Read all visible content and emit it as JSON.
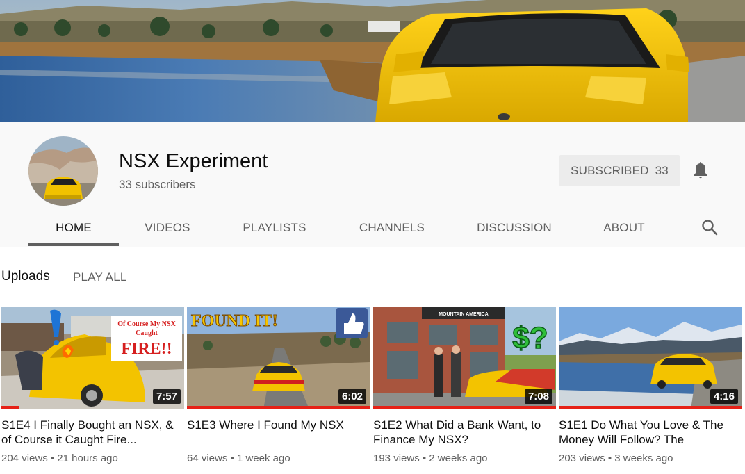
{
  "channel": {
    "name": "NSX Experiment",
    "subscribers_text": "33 subscribers"
  },
  "subscribe": {
    "label": "SUBSCRIBED",
    "count": "33"
  },
  "tabs": [
    {
      "label": "HOME"
    },
    {
      "label": "VIDEOS"
    },
    {
      "label": "PLAYLISTS"
    },
    {
      "label": "CHANNELS"
    },
    {
      "label": "DISCUSSION"
    },
    {
      "label": "ABOUT"
    }
  ],
  "active_tab": "HOME",
  "uploads": {
    "title": "Uploads",
    "play_all": "PLAY ALL"
  },
  "videos": [
    {
      "title": "S1E4 I Finally Bought an NSX, & of Course it Caught Fire...",
      "views": "204 views",
      "age": "21 hours ago",
      "duration": "7:57",
      "overlay": [
        "Of Course My NSX",
        "Caught",
        "FIRE!!"
      ],
      "watched_fraction": 0.1
    },
    {
      "title": "S1E3 Where I Found My NSX",
      "views": "64 views",
      "age": "1 week ago",
      "duration": "6:02",
      "overlay": [
        "FOUND IT!"
      ],
      "watched_fraction": 1.0
    },
    {
      "title": "S1E2 What Did a Bank Want, to Finance My NSX?",
      "views": "193 views",
      "age": "2 weeks ago",
      "duration": "7:08",
      "overlay": [
        "$?",
        "MOUNTAIN AMERICA"
      ],
      "watched_fraction": 1.0
    },
    {
      "title": "S1E1 Do What You Love & The Money Will Follow? The",
      "views": "203 views",
      "age": "3 weeks ago",
      "duration": "4:16",
      "overlay": [],
      "watched_fraction": 1.0
    }
  ],
  "colors": {
    "car_yellow": "#f4c500",
    "progress_red": "#e62117",
    "header_bg": "#f9f9f9"
  }
}
